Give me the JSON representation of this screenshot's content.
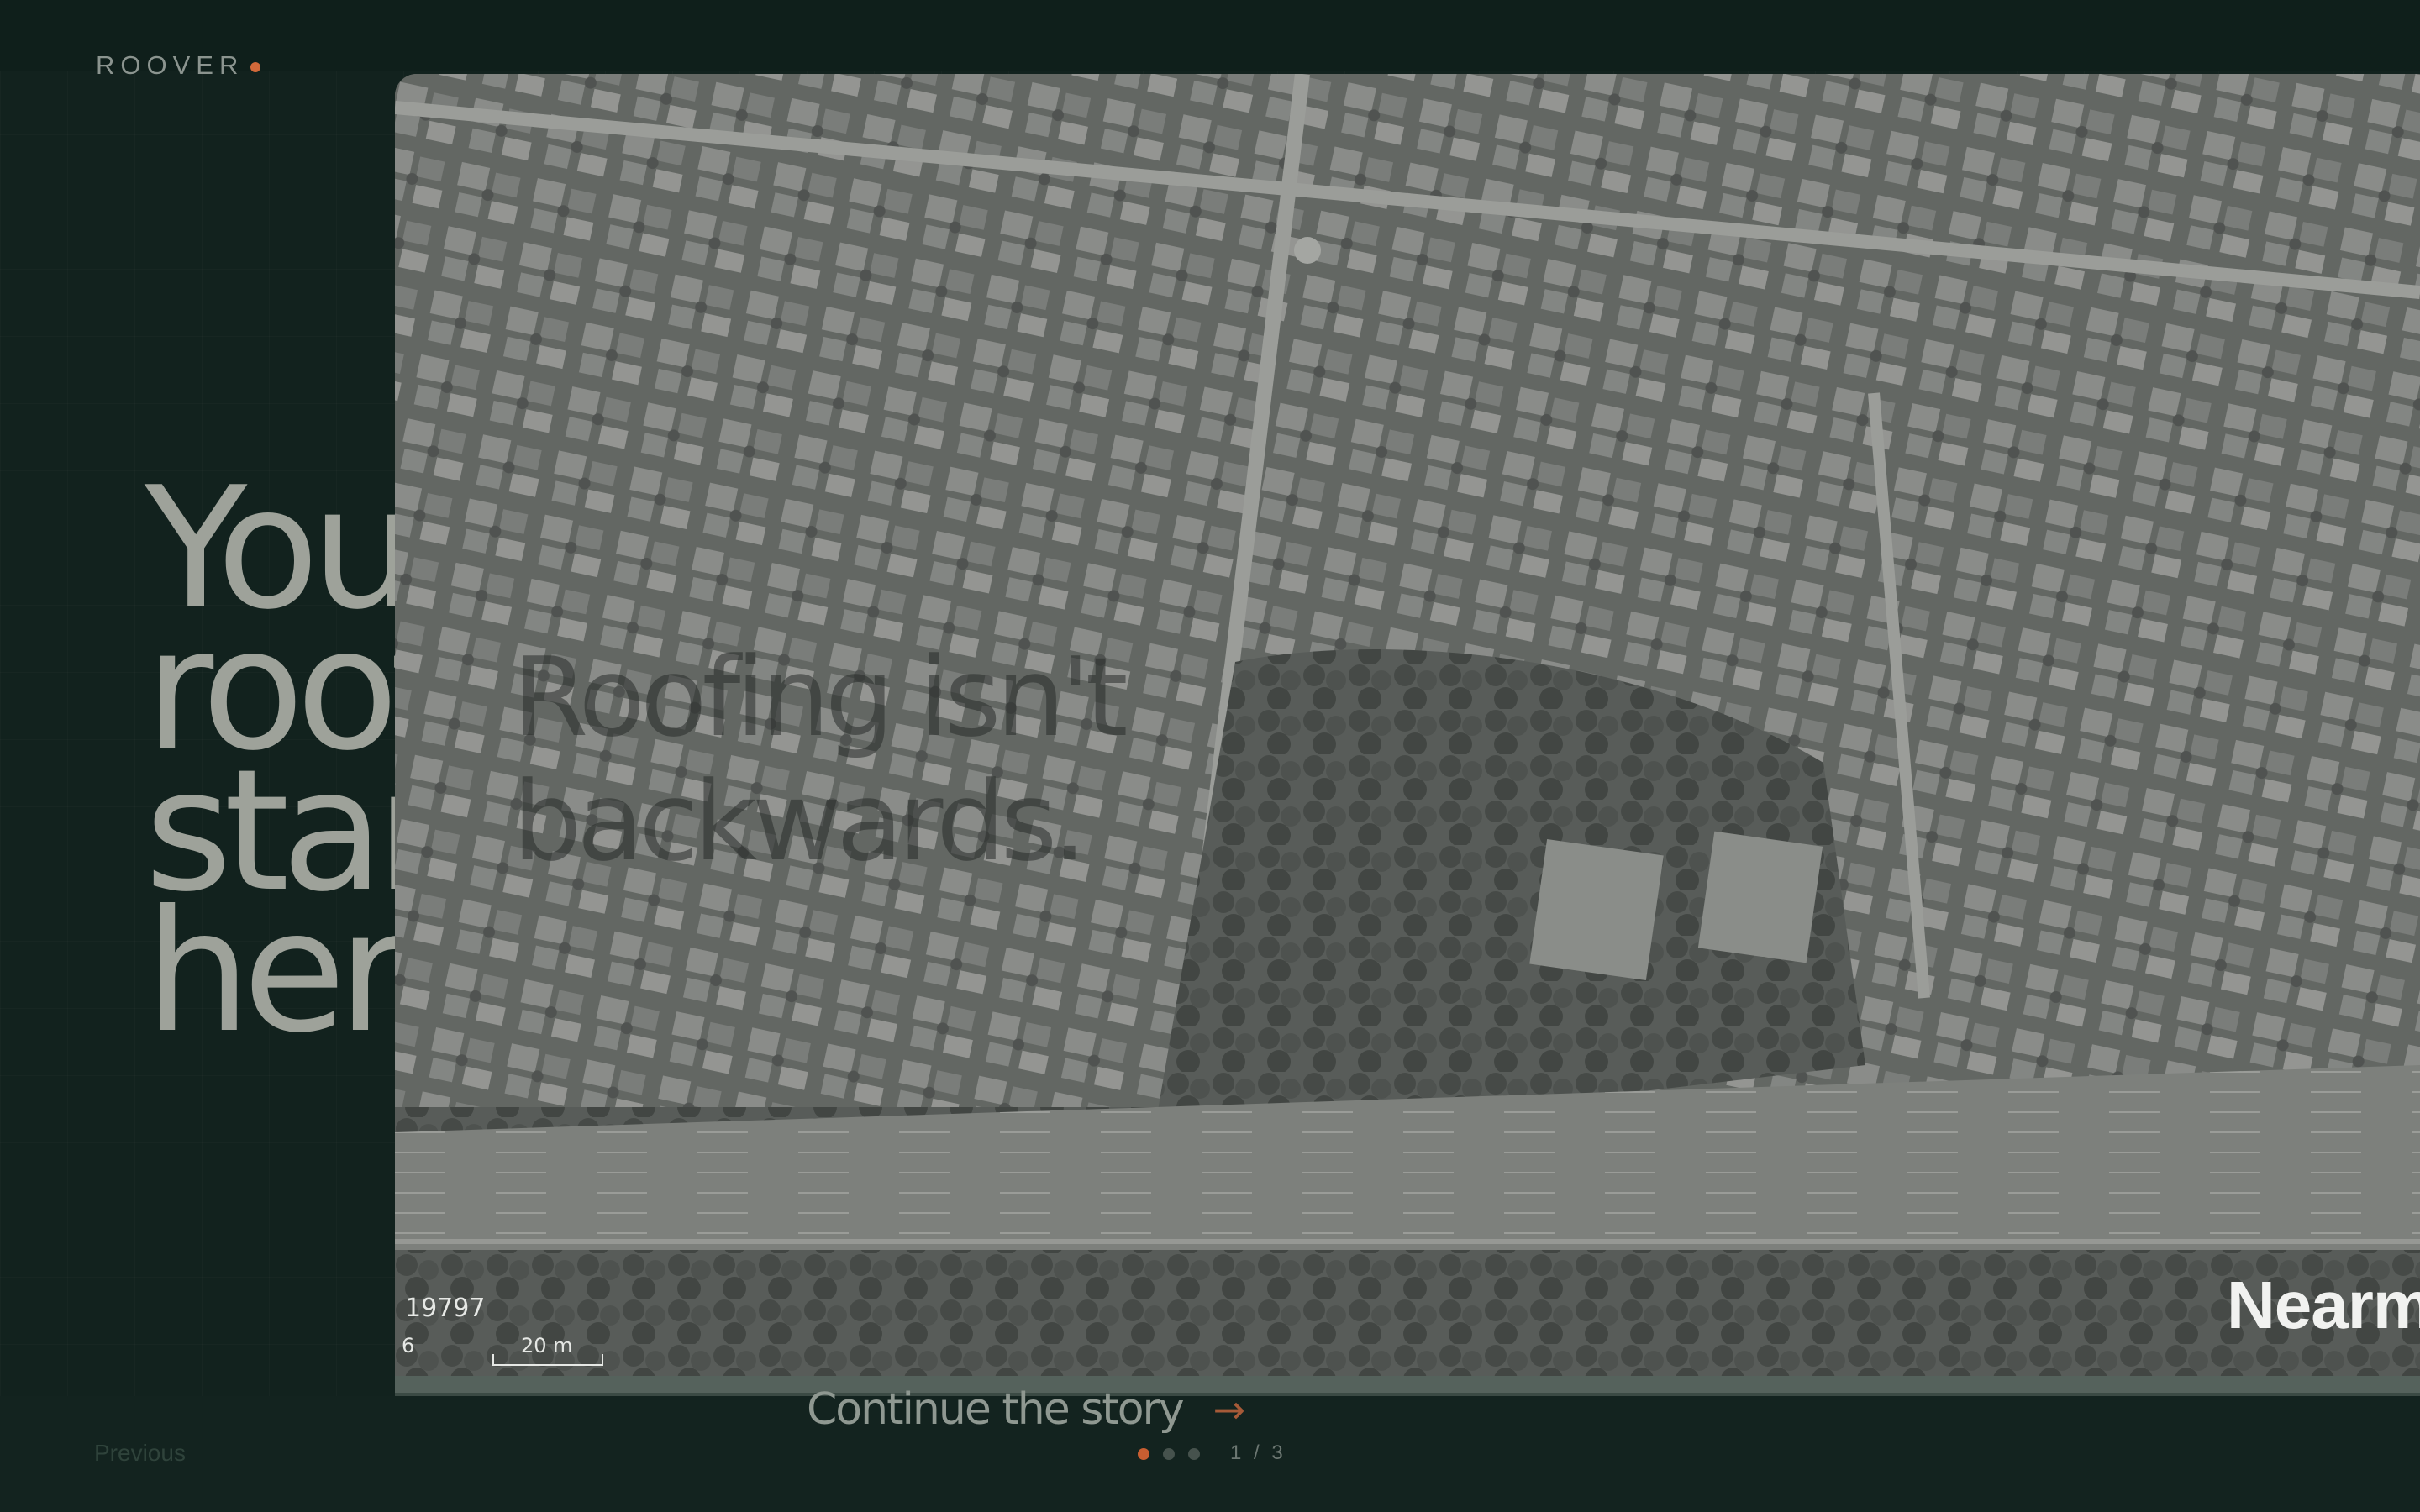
{
  "brand": {
    "name": "ROOVER",
    "accent": "#d2693a"
  },
  "hero": {
    "headline_lines": [
      "You",
      "roof",
      "star",
      "here"
    ]
  },
  "card": {
    "overlay_lines": [
      "Roofing isn't",
      "backwards."
    ],
    "stamp": "19797",
    "scale_label": "20 m",
    "scale_small": "6",
    "provider": "Nearm",
    "continue_label": "Continue the story",
    "continue_icon": "arrow-right-icon"
  },
  "nav": {
    "previous_label": "Previous",
    "slide_counter": "1 / 3",
    "dots": [
      {
        "active": true
      },
      {
        "active": false
      },
      {
        "active": false
      }
    ]
  },
  "colors": {
    "background": "#12221e",
    "accent": "#d2693a",
    "text_muted": "#9ea29a"
  }
}
